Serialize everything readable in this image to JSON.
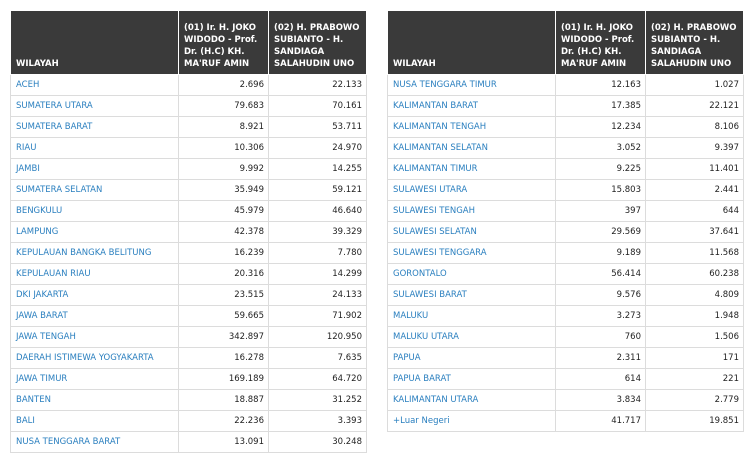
{
  "headers": {
    "region": "WILAYAH",
    "candidate1": "(01) Ir. H. JOKO WIDODO - Prof. Dr. (H.C) KH. MA'RUF AMIN",
    "candidate2": "(02) H. PRABOWO SUBIANTO - H. SANDIAGA SALAHUDIN UNO"
  },
  "left_rows": [
    {
      "region": "ACEH",
      "c1": "2.696",
      "c2": "22.133"
    },
    {
      "region": "SUMATERA UTARA",
      "c1": "79.683",
      "c2": "70.161"
    },
    {
      "region": "SUMATERA BARAT",
      "c1": "8.921",
      "c2": "53.711"
    },
    {
      "region": "RIAU",
      "c1": "10.306",
      "c2": "24.970"
    },
    {
      "region": "JAMBI",
      "c1": "9.992",
      "c2": "14.255"
    },
    {
      "region": "SUMATERA SELATAN",
      "c1": "35.949",
      "c2": "59.121"
    },
    {
      "region": "BENGKULU",
      "c1": "45.979",
      "c2": "46.640"
    },
    {
      "region": "LAMPUNG",
      "c1": "42.378",
      "c2": "39.329"
    },
    {
      "region": "KEPULAUAN BANGKA BELITUNG",
      "c1": "16.239",
      "c2": "7.780"
    },
    {
      "region": "KEPULAUAN RIAU",
      "c1": "20.316",
      "c2": "14.299"
    },
    {
      "region": "DKI JAKARTA",
      "c1": "23.515",
      "c2": "24.133"
    },
    {
      "region": "JAWA BARAT",
      "c1": "59.665",
      "c2": "71.902"
    },
    {
      "region": "JAWA TENGAH",
      "c1": "342.897",
      "c2": "120.950"
    },
    {
      "region": "DAERAH ISTIMEWA YOGYAKARTA",
      "c1": "16.278",
      "c2": "7.635"
    },
    {
      "region": "JAWA TIMUR",
      "c1": "169.189",
      "c2": "64.720"
    },
    {
      "region": "BANTEN",
      "c1": "18.887",
      "c2": "31.252"
    },
    {
      "region": "BALI",
      "c1": "22.236",
      "c2": "3.393"
    },
    {
      "region": "NUSA TENGGARA BARAT",
      "c1": "13.091",
      "c2": "30.248"
    }
  ],
  "right_rows": [
    {
      "region": "NUSA TENGGARA TIMUR",
      "c1": "12.163",
      "c2": "1.027"
    },
    {
      "region": "KALIMANTAN BARAT",
      "c1": "17.385",
      "c2": "22.121"
    },
    {
      "region": "KALIMANTAN TENGAH",
      "c1": "12.234",
      "c2": "8.106"
    },
    {
      "region": "KALIMANTAN SELATAN",
      "c1": "3.052",
      "c2": "9.397"
    },
    {
      "region": "KALIMANTAN TIMUR",
      "c1": "9.225",
      "c2": "11.401"
    },
    {
      "region": "SULAWESI UTARA",
      "c1": "15.803",
      "c2": "2.441"
    },
    {
      "region": "SULAWESI TENGAH",
      "c1": "397",
      "c2": "644"
    },
    {
      "region": "SULAWESI SELATAN",
      "c1": "29.569",
      "c2": "37.641"
    },
    {
      "region": "SULAWESI TENGGARA",
      "c1": "9.189",
      "c2": "11.568"
    },
    {
      "region": "GORONTALO",
      "c1": "56.414",
      "c2": "60.238"
    },
    {
      "region": "SULAWESI BARAT",
      "c1": "9.576",
      "c2": "4.809"
    },
    {
      "region": "MALUKU",
      "c1": "3.273",
      "c2": "1.948"
    },
    {
      "region": "MALUKU UTARA",
      "c1": "760",
      "c2": "1.506"
    },
    {
      "region": "PAPUA",
      "c1": "2.311",
      "c2": "171"
    },
    {
      "region": "PAPUA BARAT",
      "c1": "614",
      "c2": "221"
    },
    {
      "region": "KALIMANTAN UTARA",
      "c1": "3.834",
      "c2": "2.779"
    },
    {
      "region": "+Luar Negeri",
      "c1": "41.717",
      "c2": "19.851"
    }
  ],
  "colors": {
    "header_bg": "#3a3a3a",
    "link": "#2a7fbf"
  }
}
